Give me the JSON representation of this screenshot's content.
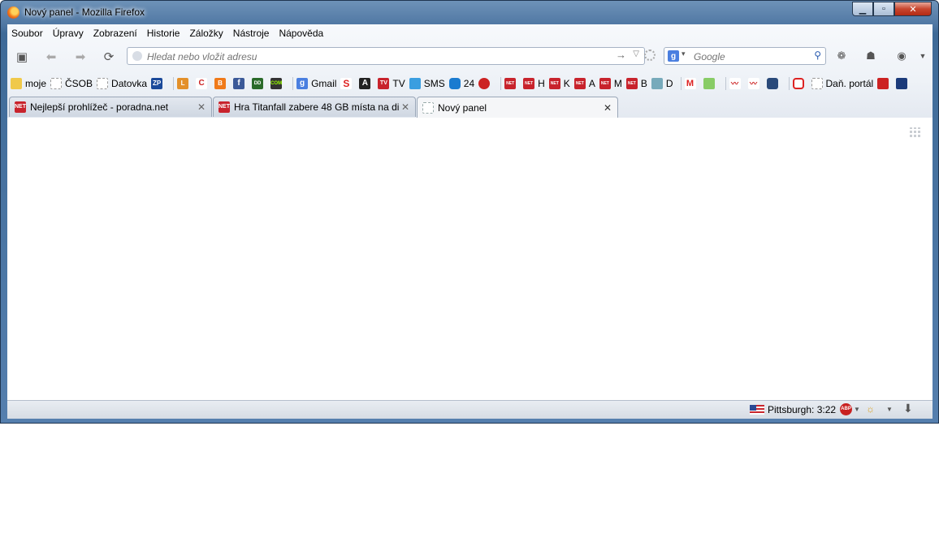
{
  "window": {
    "title": "Nový panel - Mozilla Firefox"
  },
  "menu": [
    "Soubor",
    "Úpravy",
    "Zobrazení",
    "Historie",
    "Záložky",
    "Nástroje",
    "Nápověda"
  ],
  "urlbar": {
    "placeholder": "Hledat nebo vložit adresu"
  },
  "searchbar": {
    "placeholder": "Google",
    "engine_letter": "g"
  },
  "bookmarks": {
    "moje": "moje",
    "csob": "ČSOB",
    "datovka": "Datovka",
    "gmail": "Gmail",
    "tv": "TV",
    "sms": "SMS",
    "n24": "24",
    "h": "H",
    "k": "K",
    "a": "A",
    "m": "M",
    "b": "B",
    "d": "D",
    "dan": "Daň. portál",
    "ic_lidovky": "L",
    "ic_cc": "C",
    "ic_blogger": "B",
    "ic_fb": "f",
    "ic_s": "S",
    "ic_a": "A",
    "ic_tv": "TV",
    "ic_m": "M",
    "ic_net": "NET",
    "ic_dd": "DD",
    "ic_com": "COM"
  },
  "tabs": [
    {
      "label": "Nejlepší prohlížeč - poradna.net"
    },
    {
      "label": "Hra Titanfall zabere 48 GB místa na di..."
    },
    {
      "label": "Nový panel"
    }
  ],
  "status": {
    "weather": "Pittsburgh: 3:22",
    "abp": "ABP"
  },
  "colors": {
    "accent": "#3e6a97",
    "net_red": "#c8232c"
  }
}
